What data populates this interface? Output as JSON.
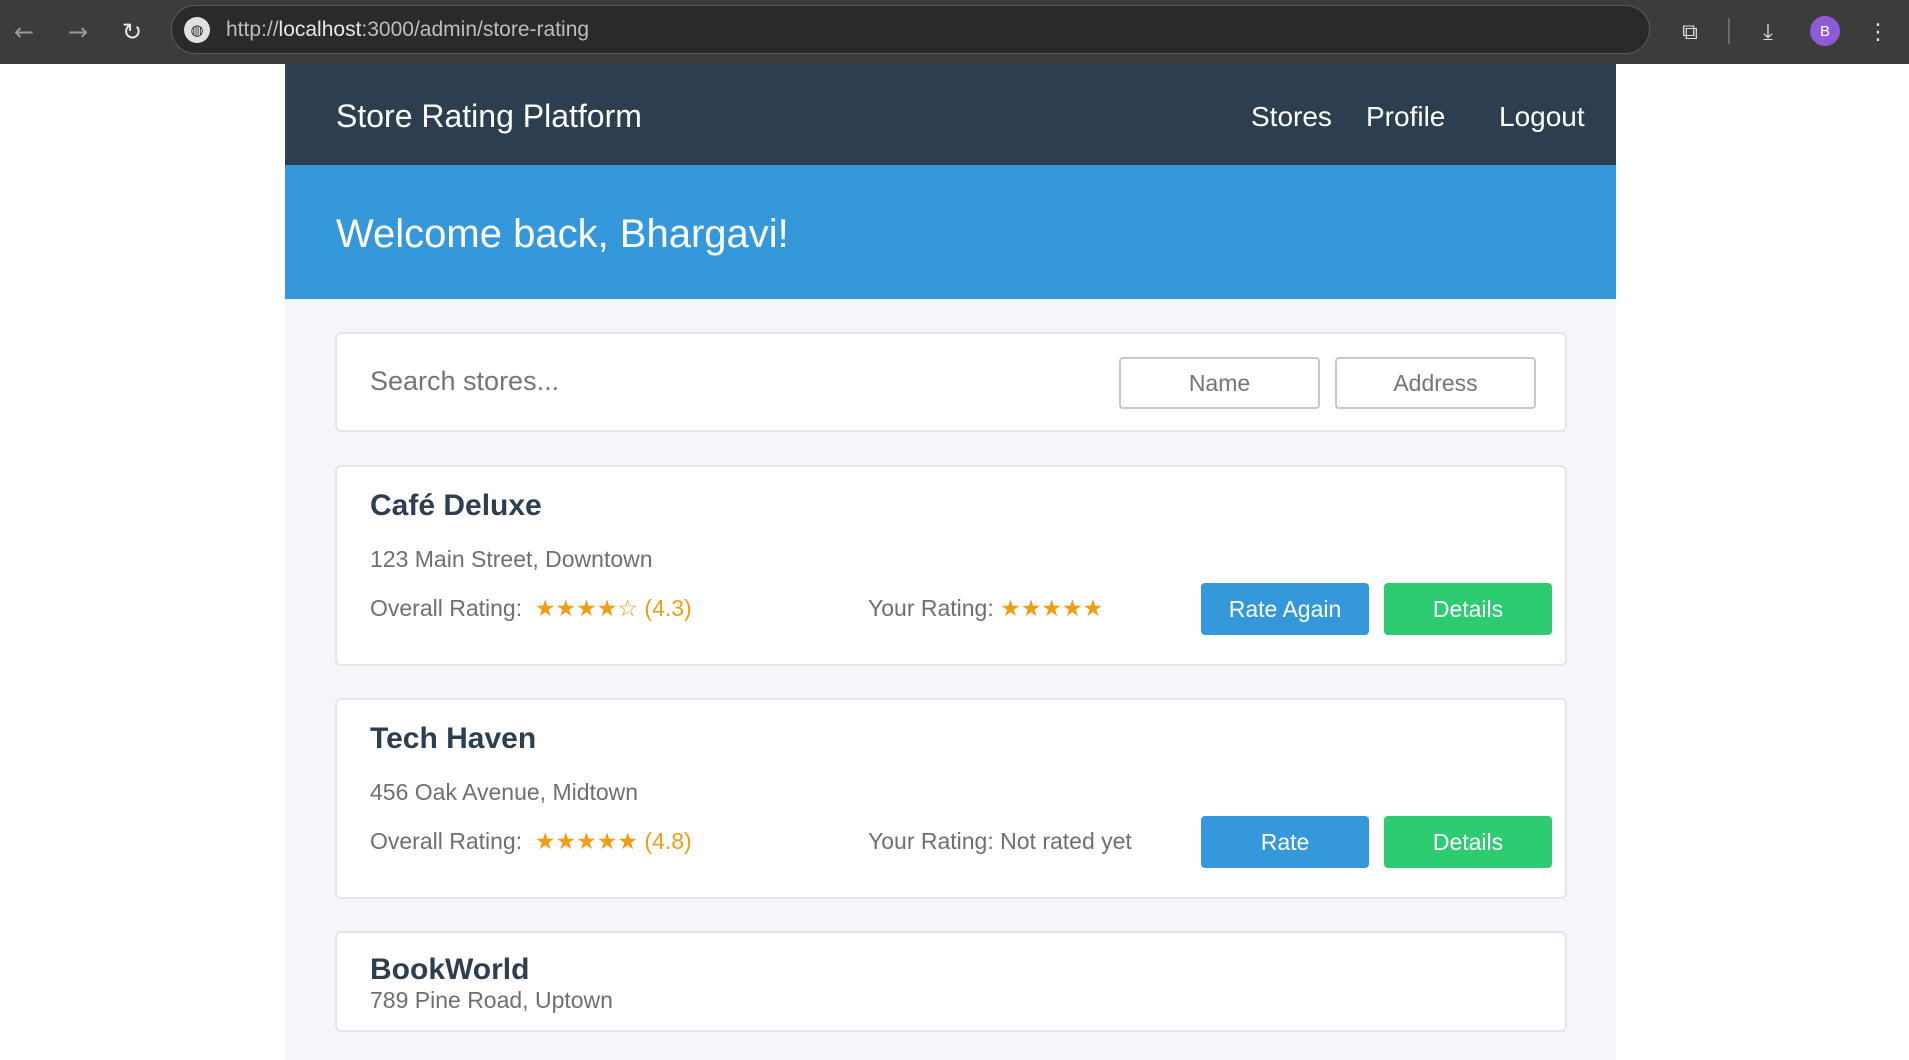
{
  "browser": {
    "url_prefix": "http://",
    "url_host": "localhost",
    "url_rest": ":3000/admin/store-rating",
    "profile_initial": "B",
    "icons": {
      "back": "←",
      "forward": "→",
      "reload": "↻",
      "site_info": "◍",
      "extensions": "⧉",
      "download": "⤓",
      "menu": "⋮"
    }
  },
  "header": {
    "brand": "Store Rating Platform",
    "nav": [
      "Stores",
      "Profile",
      "Logout"
    ]
  },
  "hero": {
    "welcome": "Welcome back, Bhargavi!"
  },
  "search": {
    "placeholder": "Search stores...",
    "name_placeholder": "Name",
    "address_placeholder": "Address"
  },
  "stores": [
    {
      "name": "Café Deluxe",
      "address": "123 Main Street, Downtown",
      "overall_label": "Overall Rating:",
      "overall_stars": "★★★★☆",
      "overall_value": "(4.3)",
      "overall_rating": 4.3,
      "your_label": "Your Rating:",
      "your_value": "",
      "your_stars": "★★★★★",
      "rate_button": "Rate Again",
      "details_button": "Details"
    },
    {
      "name": "Tech Haven",
      "address": "456 Oak Avenue, Midtown",
      "overall_label": "Overall Rating:",
      "overall_stars": "★★★★★",
      "overall_value": "(4.8)",
      "overall_rating": 4.8,
      "your_label": "Your Rating:",
      "your_value": "Not rated yet",
      "your_stars": "",
      "rate_button": "Rate",
      "details_button": "Details"
    },
    {
      "name": "BookWorld",
      "address": "789 Pine Road, Uptown"
    }
  ],
  "colors": {
    "navbar": "#2c3e50",
    "hero": "#3498db",
    "primary_button": "#3498db",
    "success_button": "#2ecc71",
    "star": "#f39c12"
  }
}
